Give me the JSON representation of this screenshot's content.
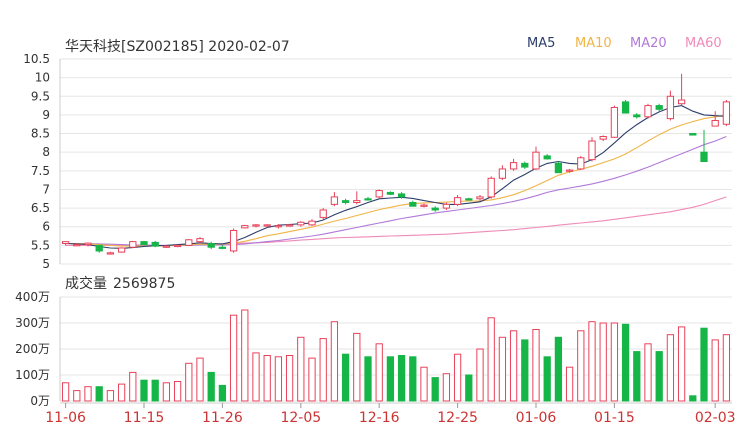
{
  "title": "华天科技[SZ002185] 2020-02-07",
  "volume_label": "成交量",
  "volume_value": "2569875",
  "colors": {
    "up": "#e8425a",
    "down": "#16b548",
    "grid": "#e6e6e6",
    "axis_text": "#333333",
    "date_text": "#cc3333",
    "ma5": "#2c3e6b",
    "ma10": "#f1b446",
    "ma20": "#b17ad9",
    "ma60": "#f08ab9"
  },
  "legend": [
    {
      "name": "MA5",
      "color": "#2c3e6b"
    },
    {
      "name": "MA10",
      "color": "#f1b446"
    },
    {
      "name": "MA20",
      "color": "#b17ad9"
    },
    {
      "name": "MA60",
      "color": "#f08ab9"
    }
  ],
  "chart_data": [
    {
      "type": "candlestick",
      "title": "华天科技[SZ002185] 2020-02-07",
      "ylim": [
        5,
        10.5
      ],
      "yticks": [
        "10.5",
        "10",
        "9.5",
        "9",
        "8.5",
        "8",
        "7.5",
        "7",
        "6.5",
        "6",
        "5.5",
        "5"
      ],
      "xticks": [
        "11-06",
        "11-15",
        "11-26",
        "12-05",
        "12-16",
        "12-25",
        "01-06",
        "01-15",
        "02-03"
      ],
      "xtick_index": [
        0,
        7,
        14,
        21,
        28,
        35,
        42,
        49,
        58
      ],
      "series_fields": [
        "open",
        "high",
        "low",
        "close"
      ],
      "candles": [
        [
          5.55,
          5.6,
          5.5,
          5.6
        ],
        [
          5.5,
          5.56,
          5.48,
          5.52
        ],
        [
          5.52,
          5.58,
          5.47,
          5.56
        ],
        [
          5.5,
          5.52,
          5.3,
          5.35
        ],
        [
          5.28,
          5.33,
          5.25,
          5.3
        ],
        [
          5.32,
          5.45,
          5.3,
          5.43
        ],
        [
          5.45,
          5.62,
          5.43,
          5.6
        ],
        [
          5.6,
          5.62,
          5.5,
          5.52
        ],
        [
          5.58,
          5.62,
          5.45,
          5.48
        ],
        [
          5.45,
          5.5,
          5.43,
          5.48
        ],
        [
          5.47,
          5.52,
          5.45,
          5.5
        ],
        [
          5.5,
          5.67,
          5.48,
          5.65
        ],
        [
          5.6,
          5.72,
          5.55,
          5.68
        ],
        [
          5.55,
          5.6,
          5.4,
          5.45
        ],
        [
          5.45,
          5.5,
          5.4,
          5.43
        ],
        [
          5.35,
          5.95,
          5.3,
          5.9
        ],
        [
          5.97,
          6.05,
          5.95,
          6.03
        ],
        [
          6.03,
          6.07,
          5.98,
          6.05
        ],
        [
          6.02,
          6.07,
          5.98,
          6.05
        ],
        [
          6.0,
          6.07,
          5.95,
          6.03
        ],
        [
          6.03,
          6.08,
          6.0,
          6.05
        ],
        [
          6.05,
          6.15,
          6.0,
          6.12
        ],
        [
          6.05,
          6.2,
          6.02,
          6.15
        ],
        [
          6.25,
          6.5,
          6.2,
          6.45
        ],
        [
          6.6,
          6.93,
          6.55,
          6.8
        ],
        [
          6.7,
          6.75,
          6.6,
          6.65
        ],
        [
          6.65,
          6.95,
          6.6,
          6.7
        ],
        [
          6.75,
          6.8,
          6.7,
          6.72
        ],
        [
          6.8,
          7.0,
          6.75,
          6.97
        ],
        [
          6.92,
          6.95,
          6.85,
          6.87
        ],
        [
          6.88,
          6.93,
          6.75,
          6.8
        ],
        [
          6.65,
          6.7,
          6.55,
          6.55
        ],
        [
          6.57,
          6.62,
          6.52,
          6.58
        ],
        [
          6.5,
          6.55,
          6.4,
          6.45
        ],
        [
          6.5,
          6.65,
          6.45,
          6.6
        ],
        [
          6.6,
          6.85,
          6.55,
          6.78
        ],
        [
          6.75,
          6.78,
          6.7,
          6.72
        ],
        [
          6.75,
          6.85,
          6.7,
          6.8
        ],
        [
          6.8,
          7.35,
          6.75,
          7.3
        ],
        [
          7.3,
          7.65,
          7.25,
          7.55
        ],
        [
          7.55,
          7.82,
          7.5,
          7.72
        ],
        [
          7.7,
          7.75,
          7.55,
          7.6
        ],
        [
          7.55,
          8.15,
          7.52,
          8.0
        ],
        [
          7.9,
          7.95,
          7.8,
          7.82
        ],
        [
          7.7,
          7.75,
          7.45,
          7.45
        ],
        [
          7.5,
          7.55,
          7.45,
          7.52
        ],
        [
          7.55,
          7.9,
          7.52,
          7.85
        ],
        [
          7.8,
          8.4,
          7.75,
          8.3
        ],
        [
          8.35,
          8.45,
          8.3,
          8.42
        ],
        [
          8.4,
          9.25,
          8.38,
          9.2
        ],
        [
          9.35,
          9.4,
          9.05,
          9.05
        ],
        [
          9.0,
          9.05,
          8.9,
          8.95
        ],
        [
          8.95,
          9.3,
          8.9,
          9.25
        ],
        [
          9.25,
          9.3,
          9.1,
          9.15
        ],
        [
          8.9,
          9.65,
          8.85,
          9.5
        ],
        [
          9.3,
          10.1,
          9.25,
          9.4
        ],
        [
          8.5,
          8.5,
          8.45,
          8.46
        ],
        [
          8.0,
          8.6,
          7.75,
          7.75
        ],
        [
          8.7,
          9.1,
          8.7,
          8.85
        ],
        [
          8.75,
          9.4,
          8.7,
          9.35
        ]
      ],
      "ma5": [
        5.55,
        5.54,
        5.52,
        5.47,
        5.43,
        5.42,
        5.44,
        5.47,
        5.49,
        5.5,
        5.52,
        5.54,
        5.57,
        5.55,
        5.54,
        5.6,
        5.71,
        5.85,
        5.98,
        6.04,
        6.06,
        6.08,
        6.1,
        6.18,
        6.32,
        6.44,
        6.54,
        6.65,
        6.75,
        6.77,
        6.79,
        6.76,
        6.7,
        6.65,
        6.6,
        6.6,
        6.63,
        6.67,
        6.8,
        7.02,
        7.25,
        7.4,
        7.57,
        7.7,
        7.75,
        7.7,
        7.68,
        7.8,
        7.99,
        8.25,
        8.52,
        8.74,
        8.93,
        9.08,
        9.2,
        9.25,
        9.1,
        9.0,
        8.98,
        8.96
      ],
      "ma10": [
        5.55,
        5.55,
        5.54,
        5.52,
        5.5,
        5.48,
        5.48,
        5.48,
        5.48,
        5.49,
        5.5,
        5.51,
        5.53,
        5.53,
        5.53,
        5.56,
        5.61,
        5.68,
        5.76,
        5.81,
        5.87,
        5.93,
        5.99,
        6.07,
        6.15,
        6.22,
        6.3,
        6.38,
        6.46,
        6.52,
        6.58,
        6.62,
        6.64,
        6.65,
        6.66,
        6.68,
        6.69,
        6.69,
        6.72,
        6.78,
        6.86,
        6.97,
        7.1,
        7.24,
        7.38,
        7.47,
        7.54,
        7.62,
        7.72,
        7.82,
        7.95,
        8.12,
        8.3,
        8.47,
        8.62,
        8.73,
        8.82,
        8.9,
        8.95,
        9.0
      ],
      "ma20": [
        5.55,
        5.55,
        5.55,
        5.54,
        5.53,
        5.52,
        5.51,
        5.51,
        5.5,
        5.5,
        5.5,
        5.5,
        5.51,
        5.51,
        5.51,
        5.52,
        5.54,
        5.57,
        5.6,
        5.63,
        5.67,
        5.71,
        5.75,
        5.8,
        5.86,
        5.92,
        5.98,
        6.04,
        6.1,
        6.16,
        6.22,
        6.27,
        6.32,
        6.37,
        6.41,
        6.45,
        6.49,
        6.53,
        6.57,
        6.62,
        6.68,
        6.75,
        6.83,
        6.92,
        6.99,
        7.04,
        7.09,
        7.15,
        7.22,
        7.3,
        7.39,
        7.49,
        7.6,
        7.72,
        7.84,
        7.96,
        8.08,
        8.2,
        8.3,
        8.42
      ],
      "ma60": [
        5.5,
        5.5,
        5.5,
        5.5,
        5.5,
        5.5,
        5.5,
        5.5,
        5.5,
        5.5,
        5.5,
        5.51,
        5.52,
        5.53,
        5.54,
        5.55,
        5.56,
        5.57,
        5.58,
        5.6,
        5.62,
        5.64,
        5.66,
        5.68,
        5.7,
        5.71,
        5.72,
        5.73,
        5.74,
        5.75,
        5.76,
        5.77,
        5.78,
        5.79,
        5.8,
        5.82,
        5.84,
        5.86,
        5.88,
        5.9,
        5.92,
        5.95,
        5.98,
        6.01,
        6.04,
        6.07,
        6.1,
        6.13,
        6.16,
        6.2,
        6.24,
        6.28,
        6.32,
        6.36,
        6.4,
        6.46,
        6.52,
        6.6,
        6.7,
        6.8
      ]
    },
    {
      "type": "bar",
      "title": "成交量 2569875",
      "ylim": [
        0,
        4000000
      ],
      "yticks": [
        "400万",
        "300万",
        "200万",
        "100万",
        "0万"
      ],
      "values": [
        700000,
        400000,
        550000,
        550000,
        400000,
        650000,
        1100000,
        800000,
        800000,
        700000,
        750000,
        1450000,
        1650000,
        1100000,
        600000,
        3300000,
        3500000,
        1850000,
        1750000,
        1700000,
        1750000,
        2450000,
        1650000,
        2400000,
        3050000,
        1800000,
        2600000,
        1700000,
        2200000,
        1700000,
        1750000,
        1700000,
        1300000,
        900000,
        1050000,
        1800000,
        1000000,
        2000000,
        3200000,
        2450000,
        2700000,
        2350000,
        2750000,
        1700000,
        2450000,
        1300000,
        2700000,
        3050000,
        3000000,
        3000000,
        2950000,
        1900000,
        2200000,
        1900000,
        2550000,
        2850000,
        200000,
        2800000,
        2350000,
        2550000
      ]
    }
  ]
}
